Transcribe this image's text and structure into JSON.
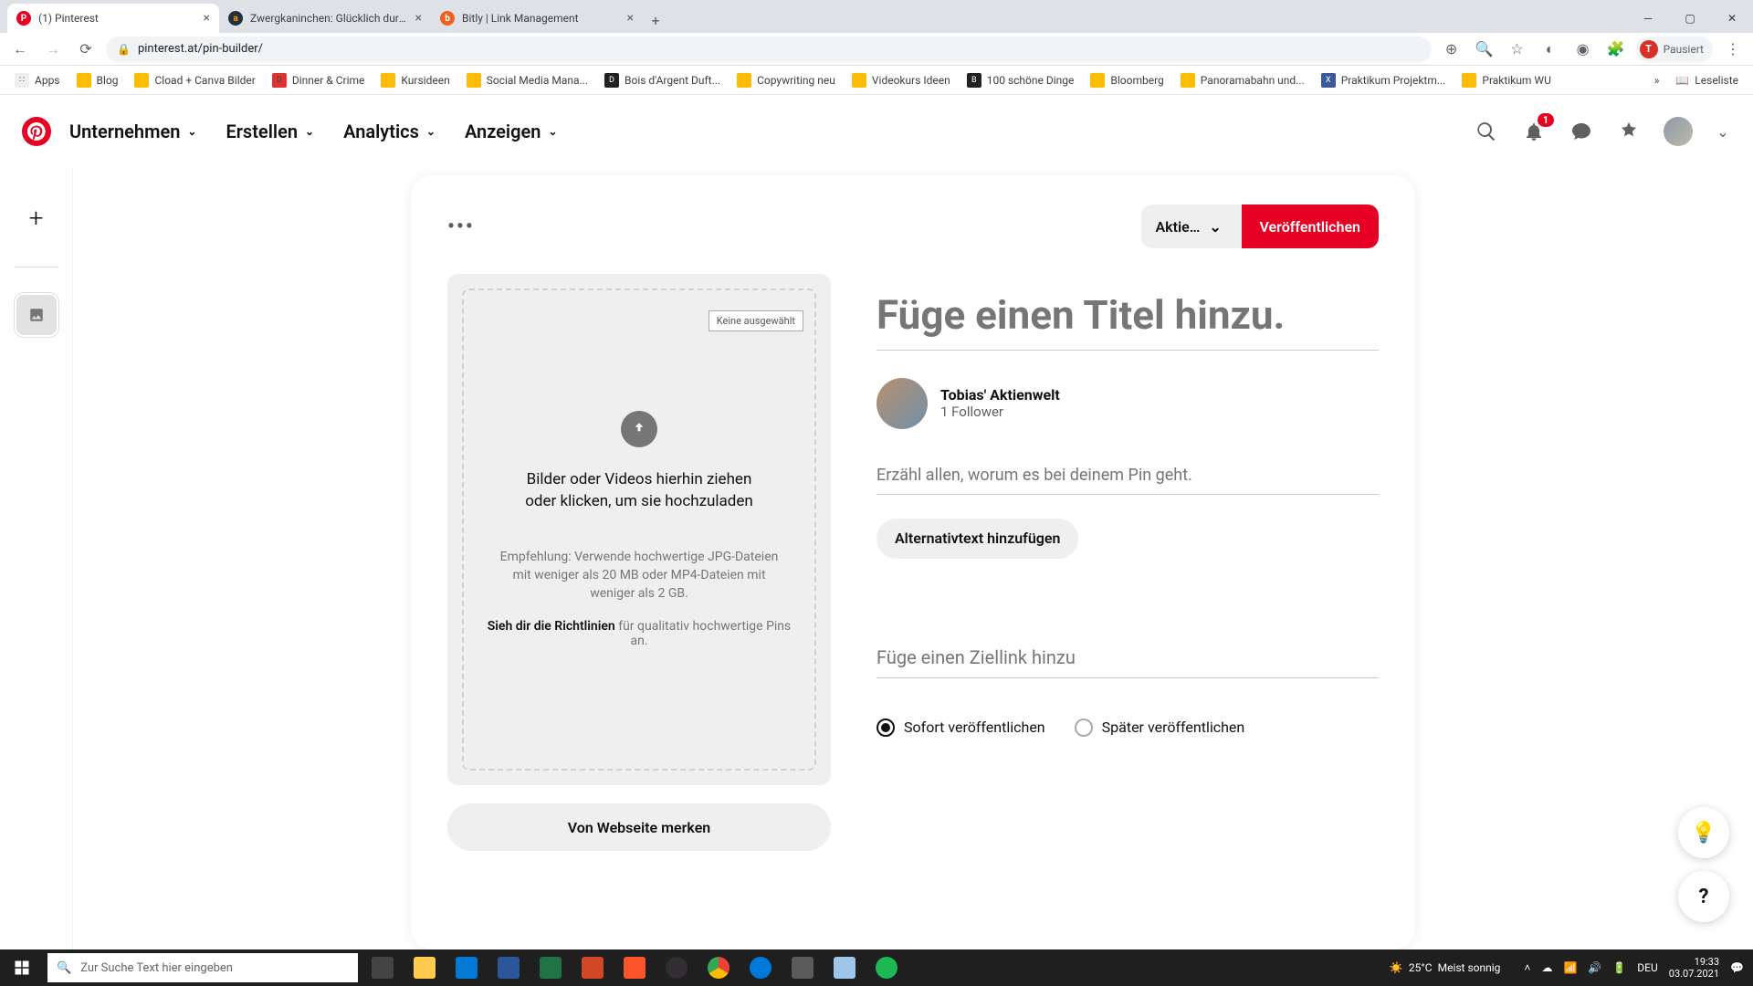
{
  "browser": {
    "tabs": [
      {
        "title": "(1) Pinterest",
        "favicon_color": "#e60023",
        "favicon_letter": "P",
        "active": true
      },
      {
        "title": "Zwergkaninchen: Glücklich durch…",
        "favicon_color": "#232f3e",
        "favicon_letter": "a",
        "active": false
      },
      {
        "title": "Bitly | Link Management",
        "favicon_color": "#ee6123",
        "favicon_letter": "b",
        "active": false
      }
    ],
    "url": "pinterest.at/pin-builder/",
    "profile_label": "Pausiert",
    "profile_initial": "T",
    "bookmarks": [
      "Apps",
      "Blog",
      "Cload + Canva Bilder",
      "Dinner & Crime",
      "Kursideen",
      "Social Media Mana...",
      "Bois d'Argent Duft...",
      "Copywriting neu",
      "Videokurs Ideen",
      "100 schöne Dinge",
      "Bloomberg",
      "Panoramabahn und...",
      "Praktikum Projektm...",
      "Praktikum WU"
    ],
    "reading_list": "Leseliste"
  },
  "pinterest": {
    "nav": {
      "business": "Unternehmen",
      "create": "Erstellen",
      "analytics": "Analytics",
      "ads": "Anzeigen"
    },
    "notification_count": "1",
    "board_selector": "Aktie…",
    "publish": "Veröffentlichen",
    "upload": {
      "file_chip": "Keine ausgewählt",
      "drop_text": "Bilder oder Videos hierhin ziehen oder klicken, um sie hochzuladen",
      "hint": "Empfehlung: Verwende hochwertige JPG-Dateien mit weniger als 20 MB oder MP4-Dateien mit weniger als 2 GB.",
      "guidelines_bold": "Sieh dir die Richtlinien",
      "guidelines_rest": " für qualitativ hochwertige Pins an.",
      "from_web": "Von Webseite merken"
    },
    "form": {
      "title_placeholder": "Füge einen Titel hinzu.",
      "author_name": "Tobias' Aktienwelt",
      "author_followers": "1 Follower",
      "desc_placeholder": "Erzähl allen, worum es bei deinem Pin geht.",
      "alt_text_btn": "Alternativtext hinzufügen",
      "link_placeholder": "Füge einen Ziellink hinzu",
      "publish_now": "Sofort veröffentlichen",
      "publish_later": "Später veröffentlichen"
    }
  },
  "taskbar": {
    "search_placeholder": "Zur Suche Text hier eingeben",
    "weather_temp": "25°C",
    "weather_text": "Meist sonnig",
    "lang": "DEU",
    "time": "19:33",
    "date": "03.07.2021"
  }
}
